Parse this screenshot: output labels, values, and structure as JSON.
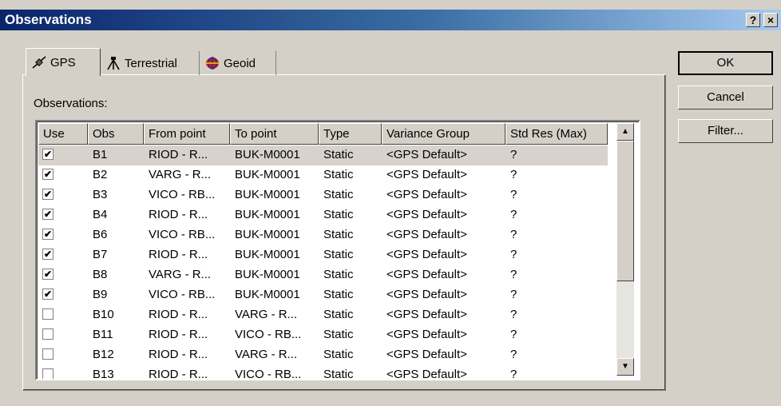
{
  "window": {
    "title": "Observations",
    "help_label": "?",
    "close_label": "×"
  },
  "tabs": [
    {
      "label": "GPS",
      "icon": "gps-satellite-icon",
      "active": true
    },
    {
      "label": "Terrestrial",
      "icon": "tripod-icon",
      "active": false
    },
    {
      "label": "Geoid",
      "icon": "geoid-icon",
      "active": false
    }
  ],
  "observations_label": "Observations:",
  "columns": [
    "Use",
    "Obs",
    "From point",
    "To point",
    "Type",
    "Variance Group",
    "Std Res (Max)"
  ],
  "rows": [
    {
      "use": true,
      "obs": "B1",
      "from": "RIOD - R...",
      "to": "BUK-M0001",
      "type": "Static",
      "variance": "<GPS Default>",
      "stdres": "?"
    },
    {
      "use": true,
      "obs": "B2",
      "from": "VARG - R...",
      "to": "BUK-M0001",
      "type": "Static",
      "variance": "<GPS Default>",
      "stdres": "?"
    },
    {
      "use": true,
      "obs": "B3",
      "from": "VICO - RB...",
      "to": "BUK-M0001",
      "type": "Static",
      "variance": "<GPS Default>",
      "stdres": "?"
    },
    {
      "use": true,
      "obs": "B4",
      "from": "RIOD - R...",
      "to": "BUK-M0001",
      "type": "Static",
      "variance": "<GPS Default>",
      "stdres": "?"
    },
    {
      "use": true,
      "obs": "B6",
      "from": "VICO - RB...",
      "to": "BUK-M0001",
      "type": "Static",
      "variance": "<GPS Default>",
      "stdres": "?"
    },
    {
      "use": true,
      "obs": "B7",
      "from": "RIOD - R...",
      "to": "BUK-M0001",
      "type": "Static",
      "variance": "<GPS Default>",
      "stdres": "?"
    },
    {
      "use": true,
      "obs": "B8",
      "from": "VARG - R...",
      "to": "BUK-M0001",
      "type": "Static",
      "variance": "<GPS Default>",
      "stdres": "?"
    },
    {
      "use": true,
      "obs": "B9",
      "from": "VICO - RB...",
      "to": "BUK-M0001",
      "type": "Static",
      "variance": "<GPS Default>",
      "stdres": "?"
    },
    {
      "use": false,
      "obs": "B10",
      "from": "RIOD - R...",
      "to": "VARG - R...",
      "type": "Static",
      "variance": "<GPS Default>",
      "stdres": "?"
    },
    {
      "use": false,
      "obs": "B11",
      "from": "RIOD - R...",
      "to": "VICO - RB...",
      "type": "Static",
      "variance": "<GPS Default>",
      "stdres": "?"
    },
    {
      "use": false,
      "obs": "B12",
      "from": "RIOD - R...",
      "to": "VARG - R...",
      "type": "Static",
      "variance": "<GPS Default>",
      "stdres": "?"
    },
    {
      "use": false,
      "obs": "B13",
      "from": "RIOD - R...",
      "to": "VICO - RB...",
      "type": "Static",
      "variance": "<GPS Default>",
      "stdres": "?"
    }
  ],
  "buttons": {
    "ok": "OK",
    "cancel": "Cancel",
    "filter": "Filter..."
  },
  "scrollbar": {
    "up_icon": "scroll-up-arrow-icon",
    "down_icon": "scroll-down-arrow-icon"
  },
  "colors": {
    "titlebar_start": "#0a246a",
    "titlebar_end": "#a6caf0",
    "dialog_face": "#d4d0c8",
    "selected_row": "#d8d2cc"
  }
}
